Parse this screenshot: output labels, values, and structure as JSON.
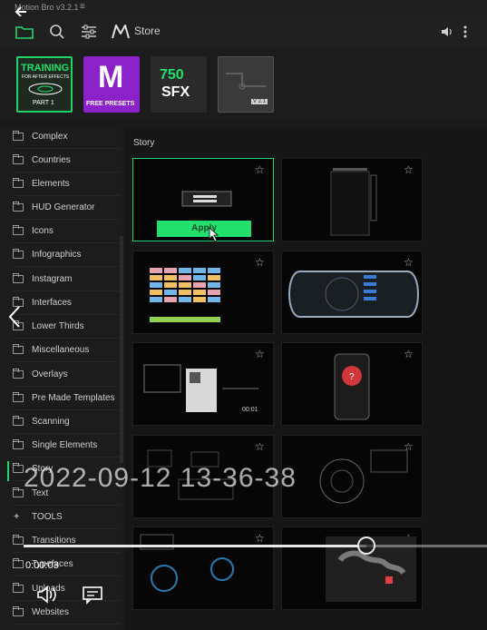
{
  "app": {
    "title": "Motion Bro v3.2.1",
    "menu_icon": "hamburger-icon"
  },
  "toolbar": {
    "store_label": "Store",
    "icons": [
      "folder-icon",
      "search-icon",
      "filters-icon",
      "motion-bro-logo-icon",
      "volume-icon",
      "more-vertical-icon"
    ]
  },
  "banners": [
    {
      "line1": "TRAINING",
      "line2": "FOR AFTER EFFECTS",
      "line3": "PART 1"
    },
    {
      "line1": "M",
      "line2": "FREE PRESETS"
    },
    {
      "line1": "750",
      "line2": "SFX"
    },
    {
      "line1": "V 2.1"
    }
  ],
  "sidebar": {
    "items": [
      {
        "label": "Complex"
      },
      {
        "label": "Countries"
      },
      {
        "label": "Elements"
      },
      {
        "label": "HUD Generator"
      },
      {
        "label": "Icons"
      },
      {
        "label": "Infographics"
      },
      {
        "label": "Instagram"
      },
      {
        "label": "Interfaces"
      },
      {
        "label": "Lower Thirds"
      },
      {
        "label": "Miscellaneous"
      },
      {
        "label": "Overlays"
      },
      {
        "label": "Pre Made Templates"
      },
      {
        "label": "Scanning"
      },
      {
        "label": "Single Elements"
      },
      {
        "label": "Story"
      },
      {
        "label": "Text"
      },
      {
        "label": "TOOLS"
      },
      {
        "label": "Transitions"
      },
      {
        "label": "Typefaces"
      },
      {
        "label": "Uploads"
      },
      {
        "label": "Websites"
      }
    ]
  },
  "content": {
    "section_title": "Story",
    "apply_label": "Apply"
  },
  "thumb_hud_time": "00:01",
  "overlay": {
    "timestamp": "2022-09-12 13-36-38",
    "current_time": "0:00:03",
    "progress": 0.74
  },
  "colors": {
    "accent": "#21d46a",
    "background": "#1a1a1a",
    "presets_purple": "#8b22c9"
  }
}
